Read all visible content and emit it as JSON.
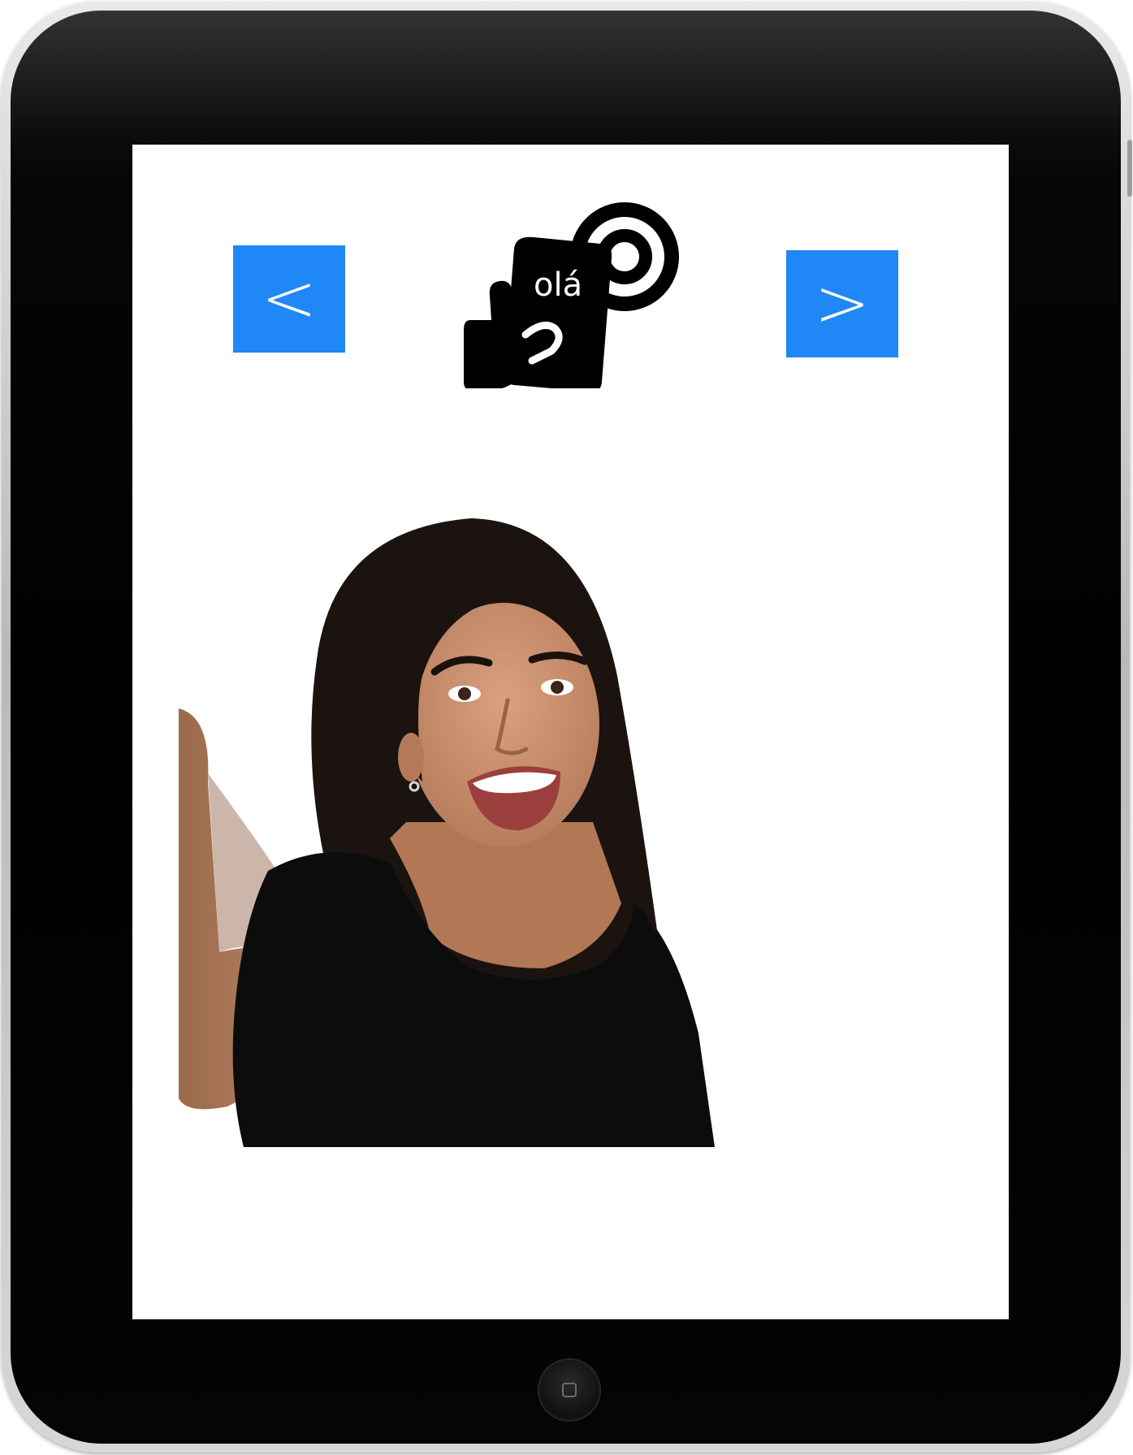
{
  "device": {
    "type": "tablet",
    "frame_color": "#000000",
    "screen_color": "#ffffff"
  },
  "navigation": {
    "prev_label": "<",
    "next_label": ">",
    "button_color": "#1f87f6"
  },
  "logo": {
    "text": "olá",
    "icon": "hand-tap-icon"
  },
  "photo": {
    "icon": "woman-selfie-photo"
  },
  "home_button": {
    "icon": "home-square-icon"
  }
}
